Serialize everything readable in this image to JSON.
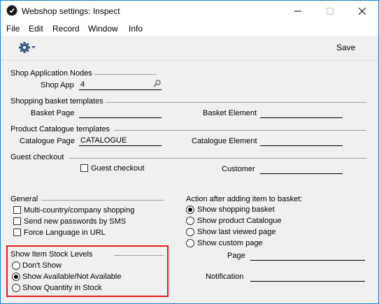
{
  "window": {
    "title": "Webshop settings: Inspect"
  },
  "menu": [
    "File",
    "Edit",
    "Record",
    "Window",
    "Info"
  ],
  "toolbar": {
    "save_label": "Save",
    "gear_icon": "gear-icon"
  },
  "shop_app_nodes": {
    "heading": "Shop Application Nodes",
    "shop_app_label": "Shop App",
    "shop_app_value": "4"
  },
  "basket_templates": {
    "heading": "Shopping basket templates",
    "basket_page_label": "Basket Page",
    "basket_page_value": "",
    "basket_element_label": "Basket Element",
    "basket_element_value": ""
  },
  "catalogue_templates": {
    "heading": "Product Catalogue templates",
    "catalogue_page_label": "Catalogue Page",
    "catalogue_page_value": "CATALOGUE",
    "catalogue_element_label": "Catalogue Element",
    "catalogue_element_value": ""
  },
  "guest_checkout": {
    "heading": "Guest checkout",
    "checkbox_label": "Guest checkout",
    "checked": false,
    "customer_label": "Customer",
    "customer_value": ""
  },
  "general": {
    "heading": "General",
    "options": [
      {
        "label": "Multi-country/company shopping",
        "checked": false
      },
      {
        "label": "Send new passwords by SMS",
        "checked": false
      },
      {
        "label": "Force Language in URL",
        "checked": false
      }
    ]
  },
  "action_after_add": {
    "heading": "Action after adding item to basket:",
    "options": [
      {
        "label": "Show shopping basket",
        "selected": true
      },
      {
        "label": "Show product Catalogue",
        "selected": false
      },
      {
        "label": "Show last viewed page",
        "selected": false
      },
      {
        "label": "Show custom page",
        "selected": false
      }
    ],
    "page_label": "Page",
    "page_value": "",
    "notification_label": "Notification",
    "notification_value": ""
  },
  "stock_levels": {
    "heading": "Show Item Stock Levels",
    "options": [
      {
        "label": "Don't Show",
        "selected": false
      },
      {
        "label": "Show Available/Not Available",
        "selected": true
      },
      {
        "label": "Show Quantity in Stock",
        "selected": false
      }
    ],
    "highlight_color": "#e51e1e"
  }
}
